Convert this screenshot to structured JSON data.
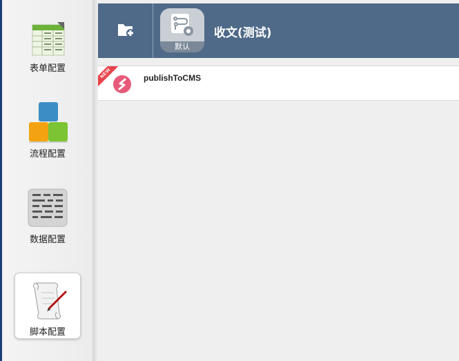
{
  "sidebar": {
    "items": [
      {
        "label": "表单配置",
        "icon": "form-table-icon",
        "selected": false
      },
      {
        "label": "流程配置",
        "icon": "process-blocks-icon",
        "selected": false
      },
      {
        "label": "数据配置",
        "icon": "data-list-icon",
        "selected": false
      },
      {
        "label": "脚本配置",
        "icon": "script-scroll-icon",
        "selected": true
      }
    ]
  },
  "header": {
    "add_button_icon": "add-folder-icon",
    "group_tile": {
      "caption": "默认",
      "icon": "flow-gear-icon"
    },
    "title": "收文(测试)"
  },
  "scripts": [
    {
      "badge": "NEW",
      "name": "publishToCMS",
      "icon": "script-s-icon"
    }
  ],
  "colors": {
    "header_bg": "#4f6a88",
    "edge": "#1c3f78",
    "badge": "#e8424a",
    "script_icon": "#e85a7a"
  }
}
